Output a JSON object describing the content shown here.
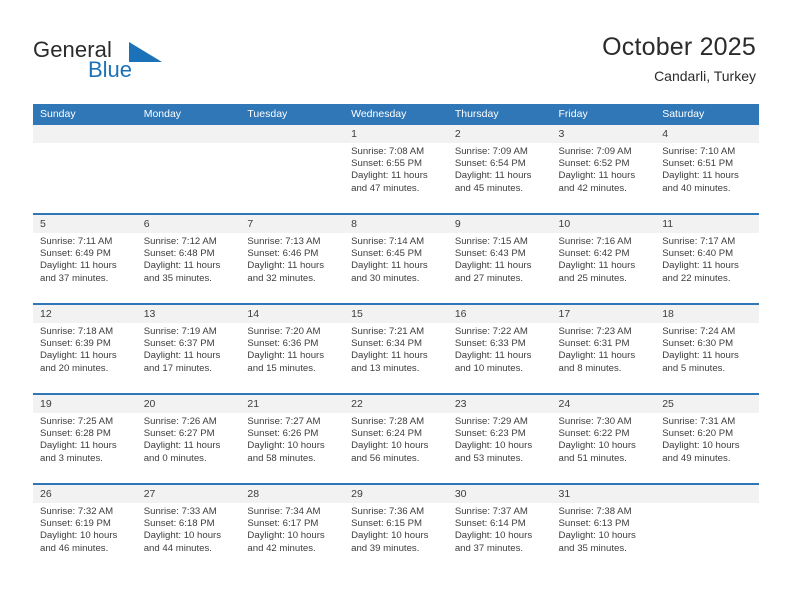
{
  "brand": {
    "name_part1": "General",
    "name_part2": "Blue",
    "accent_color": "#1c72b8",
    "logo_icon": "triangle-flag-icon"
  },
  "header": {
    "title": "October 2025",
    "subtitle": "Candarli, Turkey"
  },
  "colors": {
    "header_blue": "#3077b8",
    "row_divider_blue": "#3077b8",
    "day_header_gray": "#f2f2f2",
    "text": "#3d3d3d"
  },
  "weekday_headers": [
    "Sunday",
    "Monday",
    "Tuesday",
    "Wednesday",
    "Thursday",
    "Friday",
    "Saturday"
  ],
  "weeks": [
    [
      {
        "day": "",
        "lines": []
      },
      {
        "day": "",
        "lines": []
      },
      {
        "day": "",
        "lines": []
      },
      {
        "day": "1",
        "lines": [
          "Sunrise: 7:08 AM",
          "Sunset: 6:55 PM",
          "Daylight: 11 hours",
          "and 47 minutes."
        ]
      },
      {
        "day": "2",
        "lines": [
          "Sunrise: 7:09 AM",
          "Sunset: 6:54 PM",
          "Daylight: 11 hours",
          "and 45 minutes."
        ]
      },
      {
        "day": "3",
        "lines": [
          "Sunrise: 7:09 AM",
          "Sunset: 6:52 PM",
          "Daylight: 11 hours",
          "and 42 minutes."
        ]
      },
      {
        "day": "4",
        "lines": [
          "Sunrise: 7:10 AM",
          "Sunset: 6:51 PM",
          "Daylight: 11 hours",
          "and 40 minutes."
        ]
      }
    ],
    [
      {
        "day": "5",
        "lines": [
          "Sunrise: 7:11 AM",
          "Sunset: 6:49 PM",
          "Daylight: 11 hours",
          "and 37 minutes."
        ]
      },
      {
        "day": "6",
        "lines": [
          "Sunrise: 7:12 AM",
          "Sunset: 6:48 PM",
          "Daylight: 11 hours",
          "and 35 minutes."
        ]
      },
      {
        "day": "7",
        "lines": [
          "Sunrise: 7:13 AM",
          "Sunset: 6:46 PM",
          "Daylight: 11 hours",
          "and 32 minutes."
        ]
      },
      {
        "day": "8",
        "lines": [
          "Sunrise: 7:14 AM",
          "Sunset: 6:45 PM",
          "Daylight: 11 hours",
          "and 30 minutes."
        ]
      },
      {
        "day": "9",
        "lines": [
          "Sunrise: 7:15 AM",
          "Sunset: 6:43 PM",
          "Daylight: 11 hours",
          "and 27 minutes."
        ]
      },
      {
        "day": "10",
        "lines": [
          "Sunrise: 7:16 AM",
          "Sunset: 6:42 PM",
          "Daylight: 11 hours",
          "and 25 minutes."
        ]
      },
      {
        "day": "11",
        "lines": [
          "Sunrise: 7:17 AM",
          "Sunset: 6:40 PM",
          "Daylight: 11 hours",
          "and 22 minutes."
        ]
      }
    ],
    [
      {
        "day": "12",
        "lines": [
          "Sunrise: 7:18 AM",
          "Sunset: 6:39 PM",
          "Daylight: 11 hours",
          "and 20 minutes."
        ]
      },
      {
        "day": "13",
        "lines": [
          "Sunrise: 7:19 AM",
          "Sunset: 6:37 PM",
          "Daylight: 11 hours",
          "and 17 minutes."
        ]
      },
      {
        "day": "14",
        "lines": [
          "Sunrise: 7:20 AM",
          "Sunset: 6:36 PM",
          "Daylight: 11 hours",
          "and 15 minutes."
        ]
      },
      {
        "day": "15",
        "lines": [
          "Sunrise: 7:21 AM",
          "Sunset: 6:34 PM",
          "Daylight: 11 hours",
          "and 13 minutes."
        ]
      },
      {
        "day": "16",
        "lines": [
          "Sunrise: 7:22 AM",
          "Sunset: 6:33 PM",
          "Daylight: 11 hours",
          "and 10 minutes."
        ]
      },
      {
        "day": "17",
        "lines": [
          "Sunrise: 7:23 AM",
          "Sunset: 6:31 PM",
          "Daylight: 11 hours",
          "and 8 minutes."
        ]
      },
      {
        "day": "18",
        "lines": [
          "Sunrise: 7:24 AM",
          "Sunset: 6:30 PM",
          "Daylight: 11 hours",
          "and 5 minutes."
        ]
      }
    ],
    [
      {
        "day": "19",
        "lines": [
          "Sunrise: 7:25 AM",
          "Sunset: 6:28 PM",
          "Daylight: 11 hours",
          "and 3 minutes."
        ]
      },
      {
        "day": "20",
        "lines": [
          "Sunrise: 7:26 AM",
          "Sunset: 6:27 PM",
          "Daylight: 11 hours",
          "and 0 minutes."
        ]
      },
      {
        "day": "21",
        "lines": [
          "Sunrise: 7:27 AM",
          "Sunset: 6:26 PM",
          "Daylight: 10 hours",
          "and 58 minutes."
        ]
      },
      {
        "day": "22",
        "lines": [
          "Sunrise: 7:28 AM",
          "Sunset: 6:24 PM",
          "Daylight: 10 hours",
          "and 56 minutes."
        ]
      },
      {
        "day": "23",
        "lines": [
          "Sunrise: 7:29 AM",
          "Sunset: 6:23 PM",
          "Daylight: 10 hours",
          "and 53 minutes."
        ]
      },
      {
        "day": "24",
        "lines": [
          "Sunrise: 7:30 AM",
          "Sunset: 6:22 PM",
          "Daylight: 10 hours",
          "and 51 minutes."
        ]
      },
      {
        "day": "25",
        "lines": [
          "Sunrise: 7:31 AM",
          "Sunset: 6:20 PM",
          "Daylight: 10 hours",
          "and 49 minutes."
        ]
      }
    ],
    [
      {
        "day": "26",
        "lines": [
          "Sunrise: 7:32 AM",
          "Sunset: 6:19 PM",
          "Daylight: 10 hours",
          "and 46 minutes."
        ]
      },
      {
        "day": "27",
        "lines": [
          "Sunrise: 7:33 AM",
          "Sunset: 6:18 PM",
          "Daylight: 10 hours",
          "and 44 minutes."
        ]
      },
      {
        "day": "28",
        "lines": [
          "Sunrise: 7:34 AM",
          "Sunset: 6:17 PM",
          "Daylight: 10 hours",
          "and 42 minutes."
        ]
      },
      {
        "day": "29",
        "lines": [
          "Sunrise: 7:36 AM",
          "Sunset: 6:15 PM",
          "Daylight: 10 hours",
          "and 39 minutes."
        ]
      },
      {
        "day": "30",
        "lines": [
          "Sunrise: 7:37 AM",
          "Sunset: 6:14 PM",
          "Daylight: 10 hours",
          "and 37 minutes."
        ]
      },
      {
        "day": "31",
        "lines": [
          "Sunrise: 7:38 AM",
          "Sunset: 6:13 PM",
          "Daylight: 10 hours",
          "and 35 minutes."
        ]
      },
      {
        "day": "",
        "lines": []
      }
    ]
  ]
}
